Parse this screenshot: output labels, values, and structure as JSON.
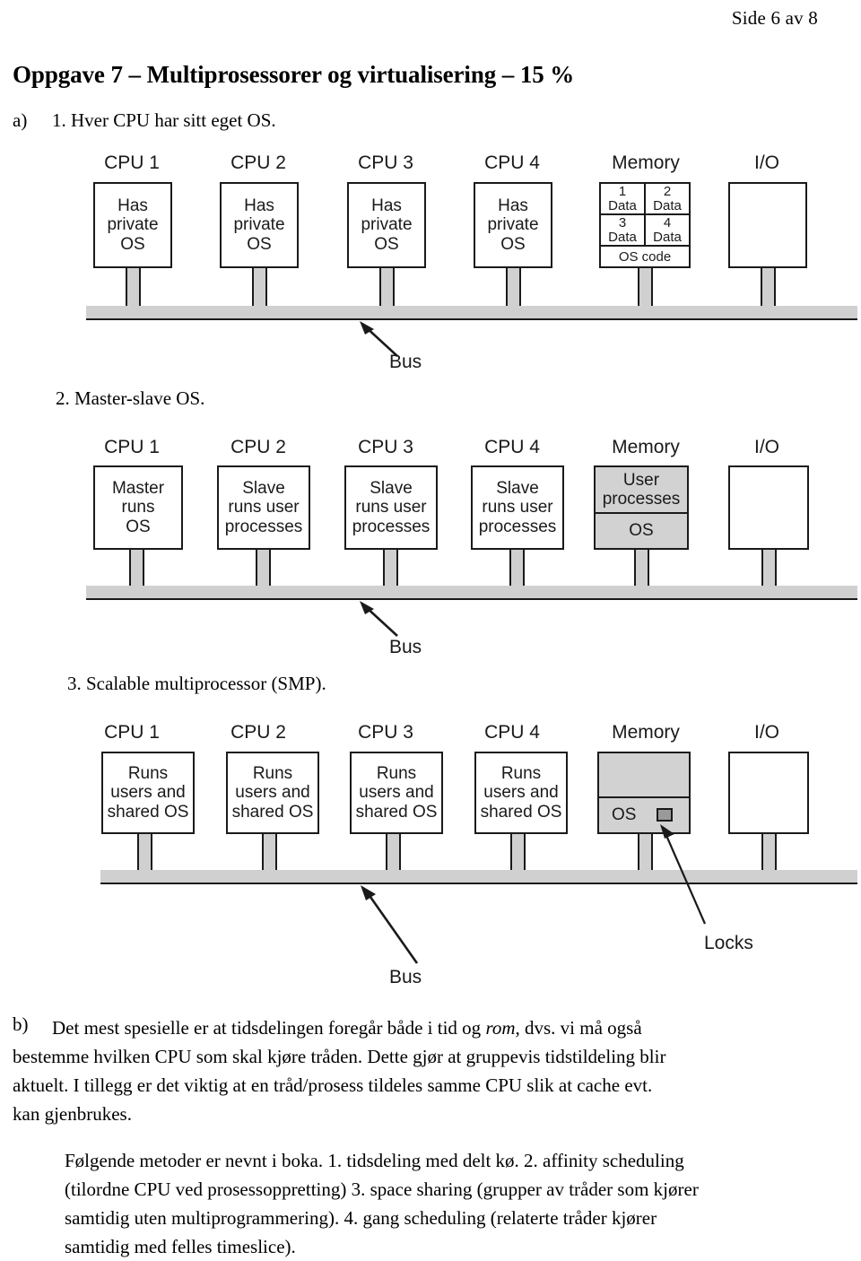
{
  "page": {
    "header": "Side 6 av 8",
    "title": "Oppgave 7 – Multiprosessorer og virtualisering – 15 %"
  },
  "items": {
    "a_marker": "a)",
    "a_text": "1. Hver CPU har sitt eget OS.",
    "b_marker": "b)",
    "item2": "2. Master-slave OS.",
    "item3": "3. Scalable multiprocessor (SMP)."
  },
  "figures": [
    {
      "id": "fig-private-os",
      "column_labels": [
        "CPU 1",
        "CPU 2",
        "CPU 3",
        "CPU 4",
        "Memory",
        "I/O"
      ],
      "cpu_boxes": [
        {
          "lines": [
            "Has",
            "private",
            "OS"
          ]
        },
        {
          "lines": [
            "Has",
            "private",
            "OS"
          ]
        },
        {
          "lines": [
            "Has",
            "private",
            "OS"
          ]
        },
        {
          "lines": [
            "Has",
            "private",
            "OS"
          ]
        }
      ],
      "memory": {
        "type": "grid",
        "cells": [
          {
            "index": "1",
            "label": "Data"
          },
          {
            "index": "2",
            "label": "Data"
          },
          {
            "index": "3",
            "label": "Data"
          },
          {
            "index": "4",
            "label": "Data"
          }
        ],
        "footer": "OS code"
      },
      "io": {
        "lines": []
      },
      "bus_label": "Bus"
    },
    {
      "id": "fig-master-slave",
      "column_labels": [
        "CPU 1",
        "CPU 2",
        "CPU 3",
        "CPU 4",
        "Memory",
        "I/O"
      ],
      "cpu_boxes": [
        {
          "lines": [
            "Master",
            "runs",
            "OS"
          ]
        },
        {
          "lines": [
            "Slave",
            "runs user",
            "processes"
          ]
        },
        {
          "lines": [
            "Slave",
            "runs user",
            "processes"
          ]
        },
        {
          "lines": [
            "Slave",
            "runs user",
            "processes"
          ]
        }
      ],
      "memory": {
        "type": "stack",
        "top": [
          "User",
          "processes"
        ],
        "bottom": "OS"
      },
      "io": {
        "lines": []
      },
      "bus_label": "Bus"
    },
    {
      "id": "fig-smp",
      "column_labels": [
        "CPU 1",
        "CPU 2",
        "CPU 3",
        "CPU 4",
        "Memory",
        "I/O"
      ],
      "cpu_boxes": [
        {
          "lines": [
            "Runs",
            "users and",
            "shared OS"
          ]
        },
        {
          "lines": [
            "Runs",
            "users and",
            "shared OS"
          ]
        },
        {
          "lines": [
            "Runs",
            "users and",
            "shared OS"
          ]
        },
        {
          "lines": [
            "Runs",
            "users and",
            "shared OS"
          ]
        }
      ],
      "memory": {
        "type": "stack",
        "top": [],
        "bottom": "OS",
        "lock_callout": "Locks"
      },
      "io": {
        "lines": []
      },
      "bus_label": "Bus"
    }
  ],
  "paragraphs": {
    "b_lines": [
      "Det mest spesielle er at tidsdelingen foregår både i tid og ",
      "rom",
      ", dvs. vi må også",
      "bestemme hvilken CPU som skal kjøre tråden. Dette gjør at gruppevis tidstildeling blir",
      "aktuelt. I tillegg er det viktig at en tråd/prosess tildeles samme CPU slik at cache evt.",
      "kan gjenbrukes."
    ],
    "c_lines": [
      "Følgende metoder er nevnt i boka. 1. tidsdeling med delt kø. 2. affinity scheduling",
      "(tilordne CPU ved prosessoppretting) 3. space sharing (grupper av tråder som kjører",
      "samtidig uten multiprogrammering). 4. gang scheduling (relaterte tråder kjører",
      "samtidig med felles timeslice)."
    ]
  },
  "colors": {
    "ink": "#1a1a1a",
    "bus": "#d0d0d0",
    "shade": "#d2d2d2",
    "lock": "#9a9a9a"
  }
}
